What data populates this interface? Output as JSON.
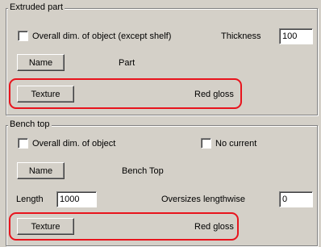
{
  "extruded_part": {
    "title": "Extruded part",
    "overall_dim_label": "Overall dim. of object (except shelf)",
    "thickness_label": "Thickness",
    "thickness_value": "100",
    "name_button": "Name",
    "name_value": "Part",
    "texture_button": "Texture",
    "texture_value": "Red gloss"
  },
  "bench_top": {
    "title": "Bench top",
    "overall_dim_label": "Overall dim. of object",
    "no_current_label": "No current",
    "name_button": "Name",
    "name_value": "Bench Top",
    "length_label": "Length",
    "length_value": "1000",
    "oversizes_label": "Oversizes lengthwise",
    "oversizes_value": "0",
    "texture_button": "Texture",
    "texture_value": "Red gloss"
  },
  "colors": {
    "background": "#d4d0c8",
    "highlight": "#e8141d"
  }
}
